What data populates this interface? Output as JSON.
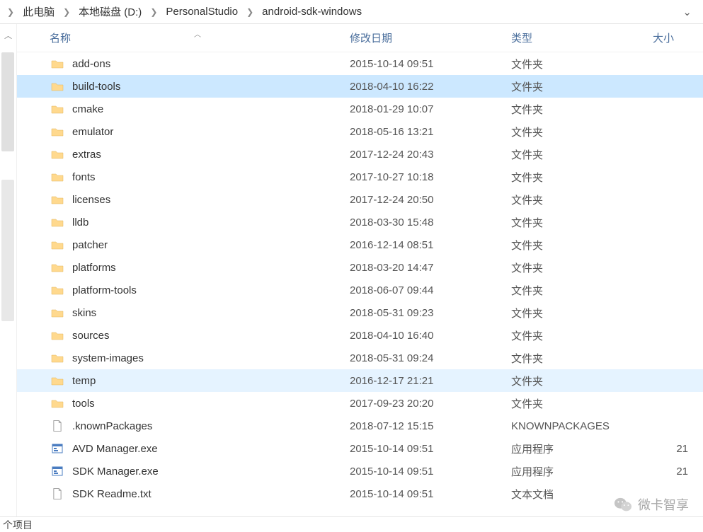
{
  "breadcrumb": {
    "items": [
      "此电脑",
      "本地磁盘 (D:)",
      "PersonalStudio",
      "android-sdk-windows"
    ]
  },
  "columns": {
    "name": "名称",
    "date": "修改日期",
    "type": "类型",
    "size": "大小"
  },
  "rows": [
    {
      "icon": "folder",
      "name": "add-ons",
      "date": "2015-10-14 09:51",
      "type": "文件夹",
      "size": "",
      "state": ""
    },
    {
      "icon": "folder",
      "name": "build-tools",
      "date": "2018-04-10 16:22",
      "type": "文件夹",
      "size": "",
      "state": "selected"
    },
    {
      "icon": "folder",
      "name": "cmake",
      "date": "2018-01-29 10:07",
      "type": "文件夹",
      "size": "",
      "state": ""
    },
    {
      "icon": "folder",
      "name": "emulator",
      "date": "2018-05-16 13:21",
      "type": "文件夹",
      "size": "",
      "state": ""
    },
    {
      "icon": "folder",
      "name": "extras",
      "date": "2017-12-24 20:43",
      "type": "文件夹",
      "size": "",
      "state": ""
    },
    {
      "icon": "folder",
      "name": "fonts",
      "date": "2017-10-27 10:18",
      "type": "文件夹",
      "size": "",
      "state": ""
    },
    {
      "icon": "folder",
      "name": "licenses",
      "date": "2017-12-24 20:50",
      "type": "文件夹",
      "size": "",
      "state": ""
    },
    {
      "icon": "folder",
      "name": "lldb",
      "date": "2018-03-30 15:48",
      "type": "文件夹",
      "size": "",
      "state": ""
    },
    {
      "icon": "folder",
      "name": "patcher",
      "date": "2016-12-14 08:51",
      "type": "文件夹",
      "size": "",
      "state": ""
    },
    {
      "icon": "folder",
      "name": "platforms",
      "date": "2018-03-20 14:47",
      "type": "文件夹",
      "size": "",
      "state": ""
    },
    {
      "icon": "folder",
      "name": "platform-tools",
      "date": "2018-06-07 09:44",
      "type": "文件夹",
      "size": "",
      "state": ""
    },
    {
      "icon": "folder",
      "name": "skins",
      "date": "2018-05-31 09:23",
      "type": "文件夹",
      "size": "",
      "state": ""
    },
    {
      "icon": "folder",
      "name": "sources",
      "date": "2018-04-10 16:40",
      "type": "文件夹",
      "size": "",
      "state": ""
    },
    {
      "icon": "folder",
      "name": "system-images",
      "date": "2018-05-31 09:24",
      "type": "文件夹",
      "size": "",
      "state": ""
    },
    {
      "icon": "folder",
      "name": "temp",
      "date": "2016-12-17 21:21",
      "type": "文件夹",
      "size": "",
      "state": "hover"
    },
    {
      "icon": "folder",
      "name": "tools",
      "date": "2017-09-23 20:20",
      "type": "文件夹",
      "size": "",
      "state": ""
    },
    {
      "icon": "file",
      "name": ".knownPackages",
      "date": "2018-07-12 15:15",
      "type": "KNOWNPACKAGES",
      "size": "",
      "state": ""
    },
    {
      "icon": "exe",
      "name": "AVD Manager.exe",
      "date": "2015-10-14 09:51",
      "type": "应用程序",
      "size": "21",
      "state": ""
    },
    {
      "icon": "exe",
      "name": "SDK Manager.exe",
      "date": "2015-10-14 09:51",
      "type": "应用程序",
      "size": "21",
      "state": ""
    },
    {
      "icon": "file",
      "name": "SDK Readme.txt",
      "date": "2015-10-14 09:51",
      "type": "文本文档",
      "size": "",
      "state": ""
    }
  ],
  "footer": {
    "label": "个项目"
  },
  "watermark": {
    "text": "微卡智享"
  }
}
